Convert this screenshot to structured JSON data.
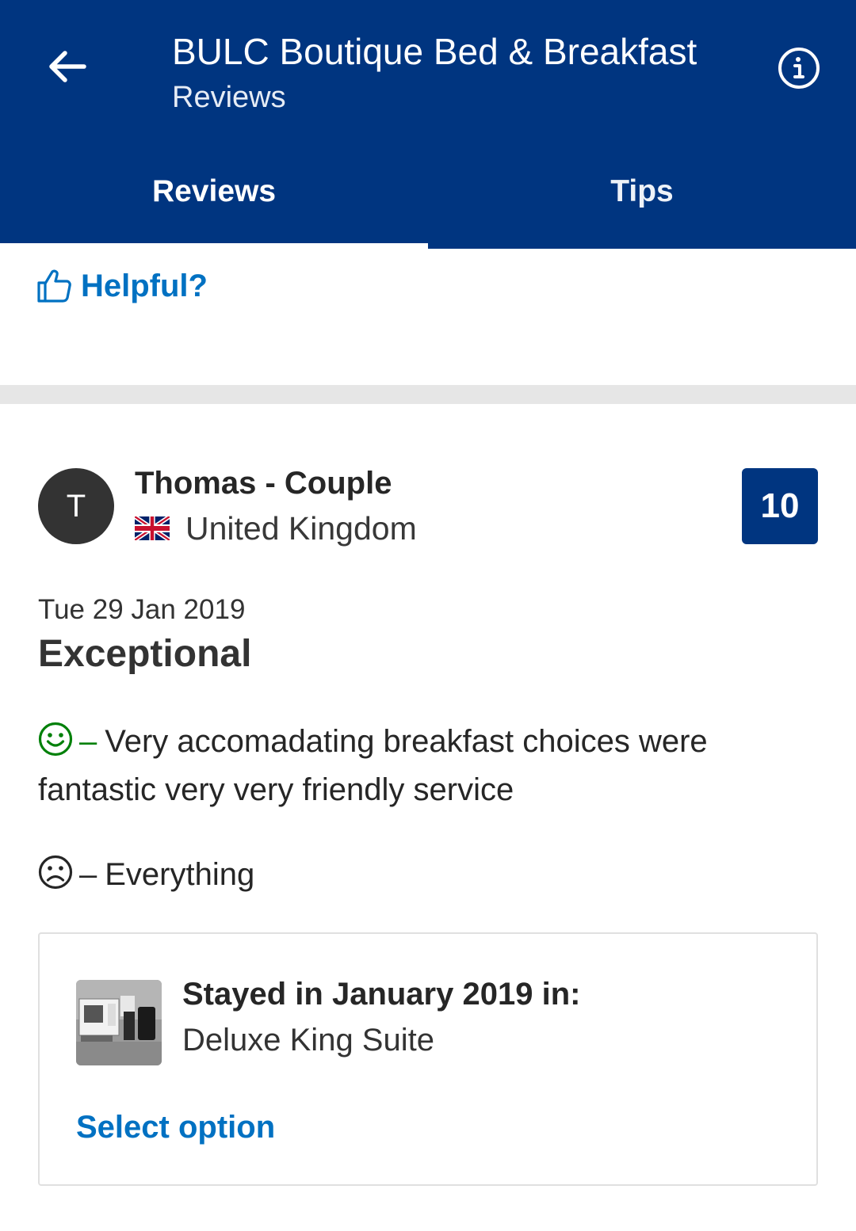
{
  "header": {
    "title": "BULC Boutique Bed & Breakfast",
    "subtitle": "Reviews",
    "back_icon": "arrow-left-icon",
    "info_icon": "info-icon"
  },
  "tabs": [
    {
      "label": "Reviews",
      "selected": true
    },
    {
      "label": "Tips",
      "selected": false
    }
  ],
  "helpful": {
    "label": "Helpful?",
    "icon": "thumbs-up-icon"
  },
  "review": {
    "avatar_initial": "T",
    "reviewer": "Thomas - Couple",
    "country": "United Kingdom",
    "flag_icon": "uk-flag-icon",
    "score": "10",
    "date": "Tue 29 Jan 2019",
    "headline": "Exceptional",
    "positive_text": "Very accomadating breakfast choices were fantastic very very friendly service",
    "negative_text": "Everything",
    "positive_dash": "–",
    "negative_dash": "–"
  },
  "stay": {
    "title": "Stayed in January 2019 in:",
    "room": "Deluxe King Suite",
    "action": "Select option"
  },
  "colors": {
    "brand_blue": "#003580",
    "link_blue": "#0071c2",
    "positive_green": "#008009"
  }
}
